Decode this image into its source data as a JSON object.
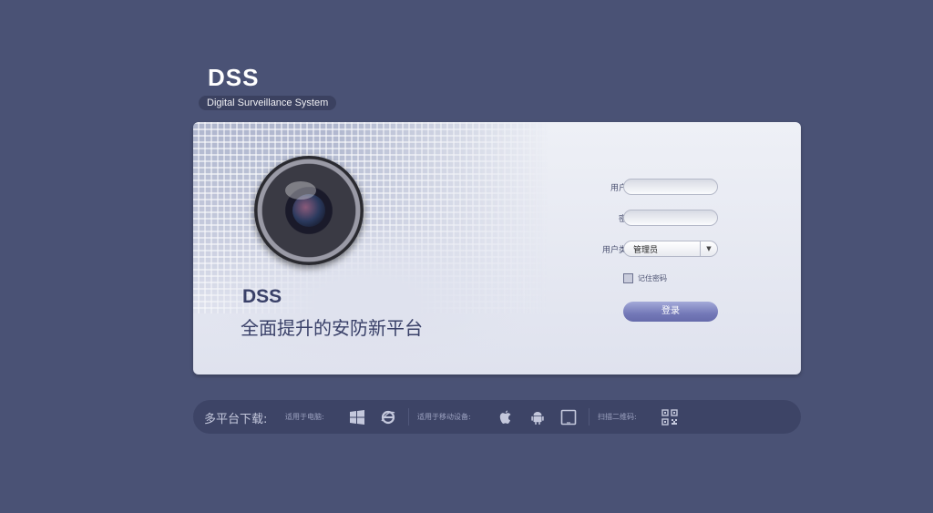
{
  "logo": {
    "title": "DSS",
    "subtitle": "Digital Surveillance System"
  },
  "hero": {
    "title": "DSS",
    "slogan": "全面提升的安防新平台"
  },
  "form": {
    "username_label": "用户名",
    "username_value": "",
    "password_label": "密码",
    "password_value": "",
    "user_type_label": "用户类型",
    "user_type_value": "管理员",
    "remember_label": "记住密码",
    "remember_checked": false,
    "login_label": "登录"
  },
  "download_bar": {
    "title": "多平台下载:",
    "pc_label": "适用于电脑:",
    "mobile_label": "适用于移动设备:",
    "qr_label": "扫描二维码:",
    "icons": [
      "windows-icon",
      "ie-icon",
      "apple-icon",
      "android-icon",
      "tablet-icon",
      "qr-code-icon"
    ]
  },
  "colors": {
    "background": "#4a5275",
    "accent": "#7479b8",
    "text_dark": "#394068"
  }
}
